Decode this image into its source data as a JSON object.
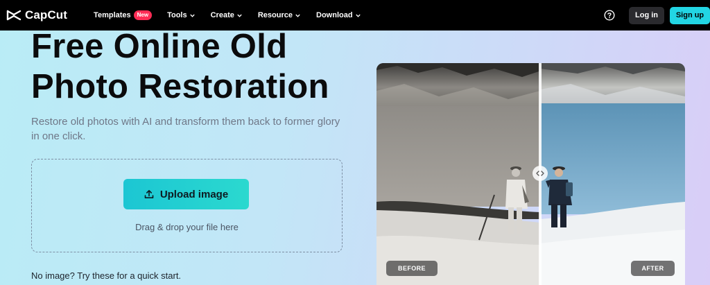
{
  "brand": {
    "name": "CapCut"
  },
  "nav": {
    "templates": "Templates",
    "templates_badge": "New",
    "tools": "Tools",
    "create": "Create",
    "resource": "Resource",
    "download": "Download",
    "login": "Log in",
    "signup": "Sign up"
  },
  "hero": {
    "title_line1": "Free Online Old",
    "title_line2": "Photo Restoration",
    "subtitle": "Restore old photos with AI and transform them back to former glory in one click."
  },
  "upload": {
    "button_label": "Upload image",
    "drop_text": "Drag & drop your file here"
  },
  "quick_start": "No image? Try these for a quick start.",
  "compare": {
    "before_label": "BEFORE",
    "after_label": "AFTER"
  },
  "colors": {
    "accent": "#22d5e4",
    "badge": "#fe2c55",
    "navbar": "#000000"
  },
  "icons": [
    "capcut-logo-icon",
    "chevron-down-icon",
    "help-icon",
    "upload-icon",
    "compare-handle-icon"
  ]
}
